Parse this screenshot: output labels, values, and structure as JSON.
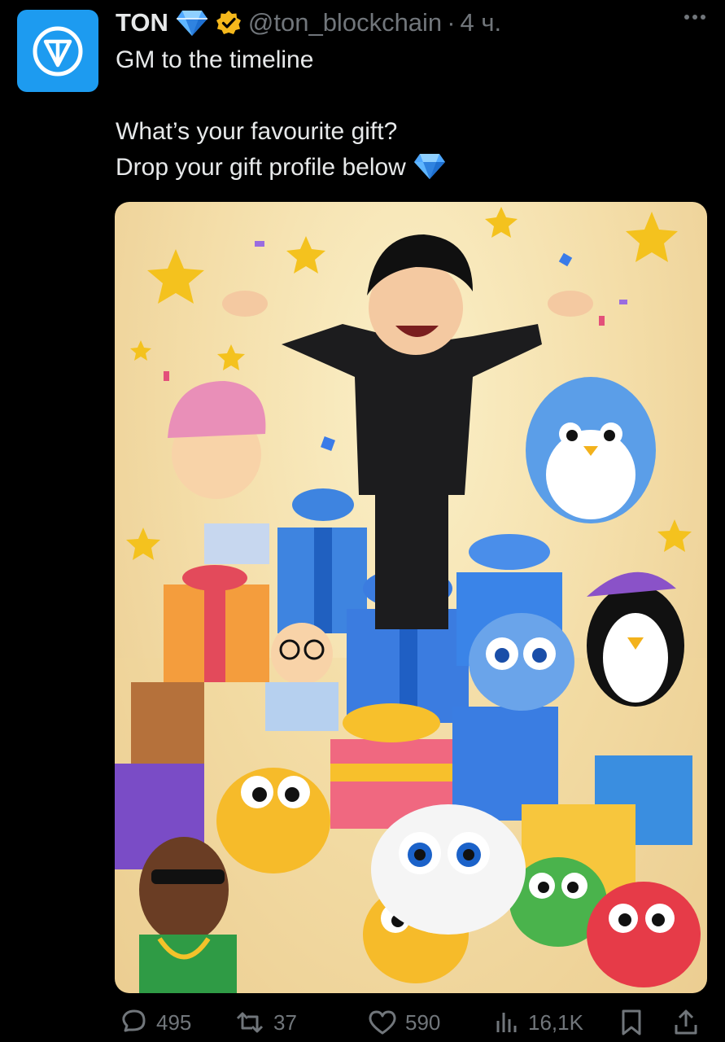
{
  "post": {
    "author_name": "TON",
    "handle": "@ton_blockchain",
    "separator": "·",
    "time": "4 ч.",
    "lines": [
      "GM to the timeline",
      "",
      "What’s your favourite gift?",
      "Drop your gift profile below"
    ],
    "avatar_icon": "ton-logo-icon",
    "badges": [
      "diamond-icon",
      "verified-gold-icon"
    ]
  },
  "media": {
    "alt_icon": "gift-collection-illustration"
  },
  "actions": {
    "replies": "495",
    "reposts": "37",
    "likes": "590",
    "views": "16,1K"
  },
  "colors": {
    "accent": "#1d9bf0",
    "muted": "#71767b",
    "text": "#e7e9ea",
    "background": "#000000",
    "gold_badge": "#f5b81c"
  }
}
